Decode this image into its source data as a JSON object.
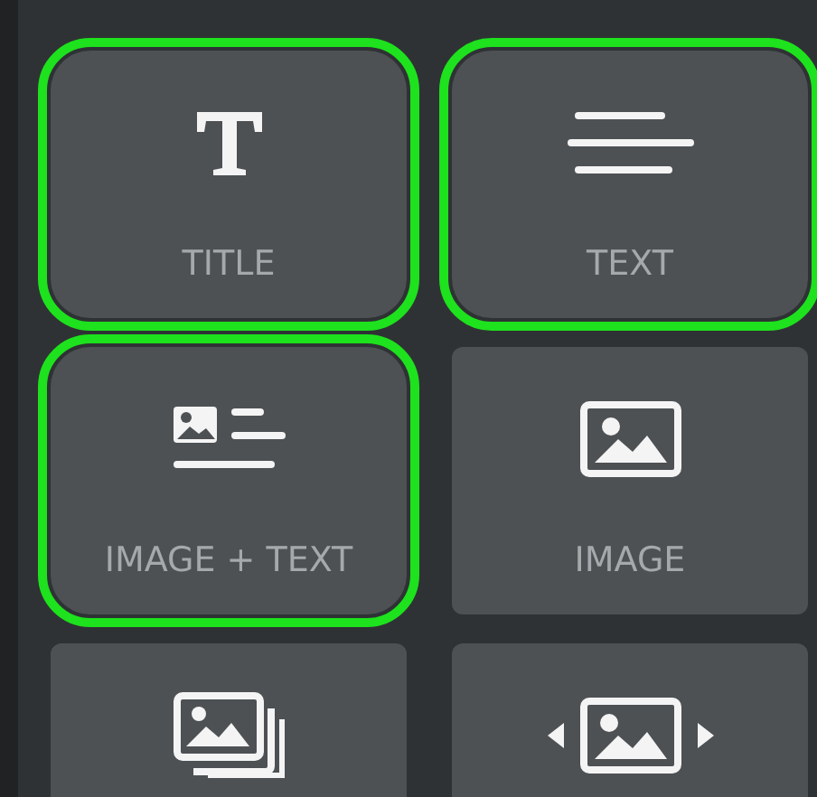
{
  "tiles": [
    {
      "kind": "title",
      "label": "TITLE",
      "highlighted": true
    },
    {
      "kind": "text",
      "label": "TEXT",
      "highlighted": true
    },
    {
      "kind": "image-text",
      "label": "IMAGE + TEXT",
      "highlighted": true
    },
    {
      "kind": "image",
      "label": "IMAGE",
      "highlighted": false
    },
    {
      "kind": "gallery",
      "highlighted": false
    },
    {
      "kind": "slider",
      "highlighted": false
    }
  ]
}
